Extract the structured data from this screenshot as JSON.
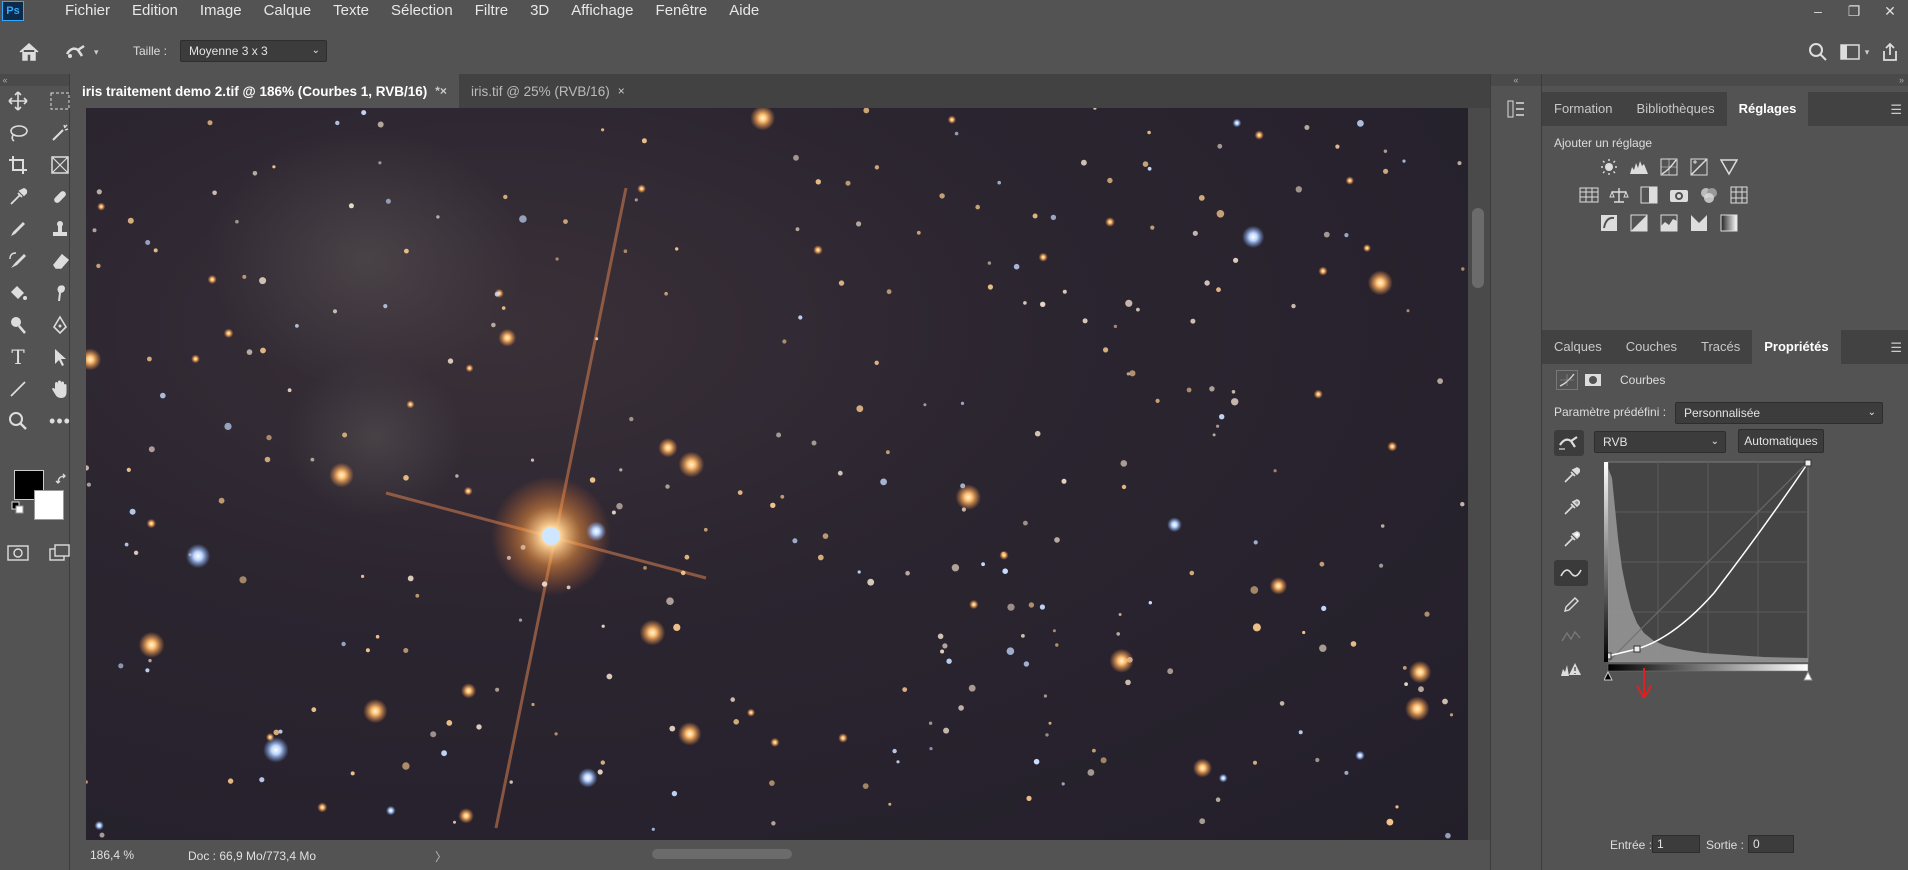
{
  "app": {
    "logo": "Ps",
    "menu": [
      "Fichier",
      "Edition",
      "Image",
      "Calque",
      "Texte",
      "Sélection",
      "Filtre",
      "3D",
      "Affichage",
      "Fenêtre",
      "Aide"
    ],
    "window_controls": [
      "minimize-icon",
      "restore-icon",
      "close-icon"
    ]
  },
  "options_bar": {
    "taille_label": "Taille :",
    "taille_value": "Moyenne 3 x 3"
  },
  "doc_tabs": [
    {
      "label": "iris traitement demo 2.tif @ 186% (Courbes 1, RVB/16)",
      "close": "*×",
      "active": true
    },
    {
      "label": "iris.tif @ 25% (RVB/16)",
      "close": "×",
      "active": false
    }
  ],
  "status": {
    "zoom": "186,4 %",
    "doc_info": "Doc : 66,9 Mo/773,4 Mo",
    "arrow": "〉"
  },
  "top_panel": {
    "tabs": [
      "Formation",
      "Bibliothèques",
      "Réglages"
    ],
    "active_tab": "Réglages",
    "heading": "Ajouter un réglage"
  },
  "props_panel": {
    "tabs": [
      "Calques",
      "Couches",
      "Tracés",
      "Propriétés"
    ],
    "active_tab": "Propriétés",
    "title": "Courbes",
    "preset_label": "Paramètre prédéfini :",
    "preset_value": "Personnalisée",
    "channel_value": "RVB",
    "auto_button": "Automatiques",
    "entree_label": "Entrée :",
    "entree_value": "1",
    "sortie_label": "Sortie :",
    "sortie_value": "0"
  },
  "colors": {
    "ui_bg": "#535353",
    "tab_bg": "#424242",
    "accent_blue": "#31a8ff",
    "arrow_red": "#e02020"
  }
}
